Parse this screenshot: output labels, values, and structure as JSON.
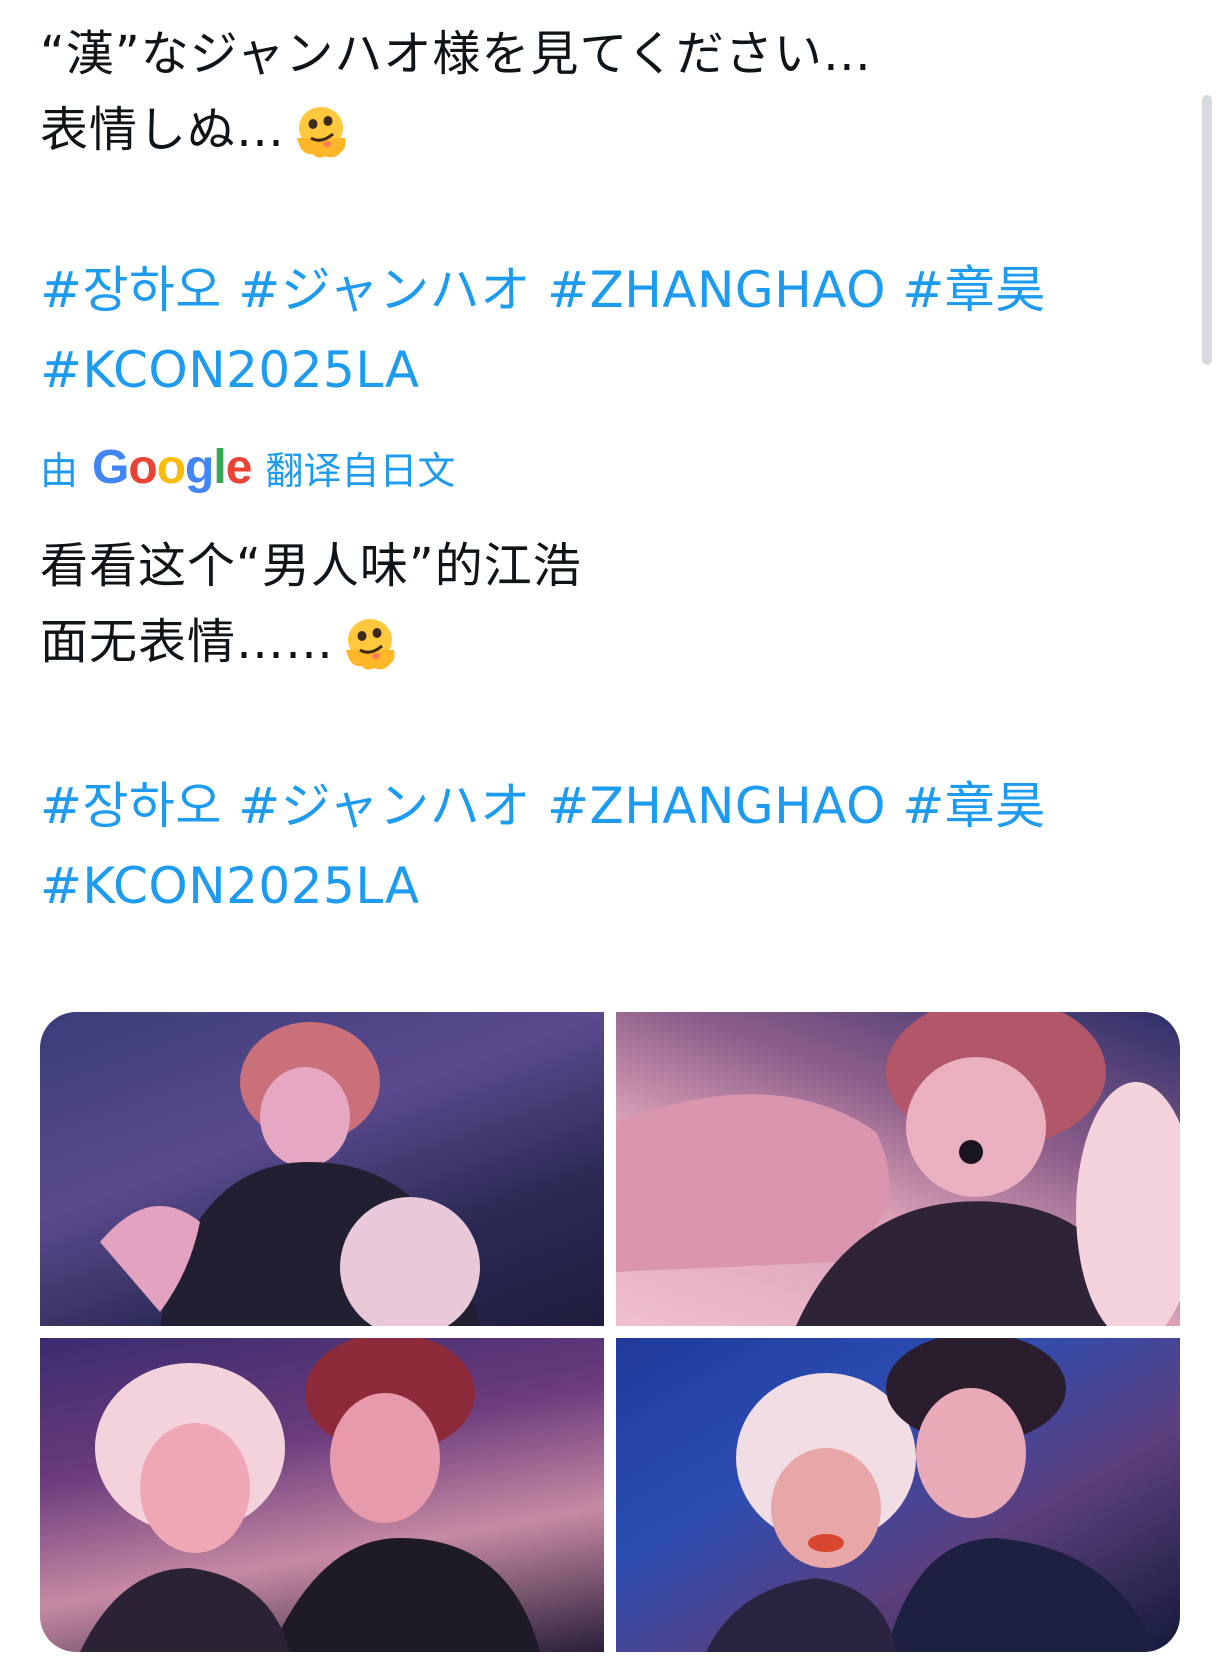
{
  "tweet": {
    "original_lines": [
      "“漢”なジャンハオ様を見てください…",
      "表情しぬ…"
    ],
    "original_hashtags": [
      "#장하오 #ジャンハオ #ZHANGHAO #章昊",
      "#KCON2025LA"
    ],
    "translate": {
      "prefix": "由",
      "provider": "Google",
      "suffix": "翻译自日文"
    },
    "translated_lines": [
      "看看这个“男人味”的江浩",
      "面无表情……"
    ],
    "translated_hashtags": [
      "#장하오 #ジャンハオ #ZHANGHAO #章昊",
      "#KCON2025LA"
    ],
    "emoji": "melting-face",
    "link_color": "#1d9bf0"
  },
  "media": {
    "photos": [
      {
        "name": "photo-1"
      },
      {
        "name": "photo-2"
      },
      {
        "name": "photo-3"
      },
      {
        "name": "photo-4"
      }
    ]
  }
}
